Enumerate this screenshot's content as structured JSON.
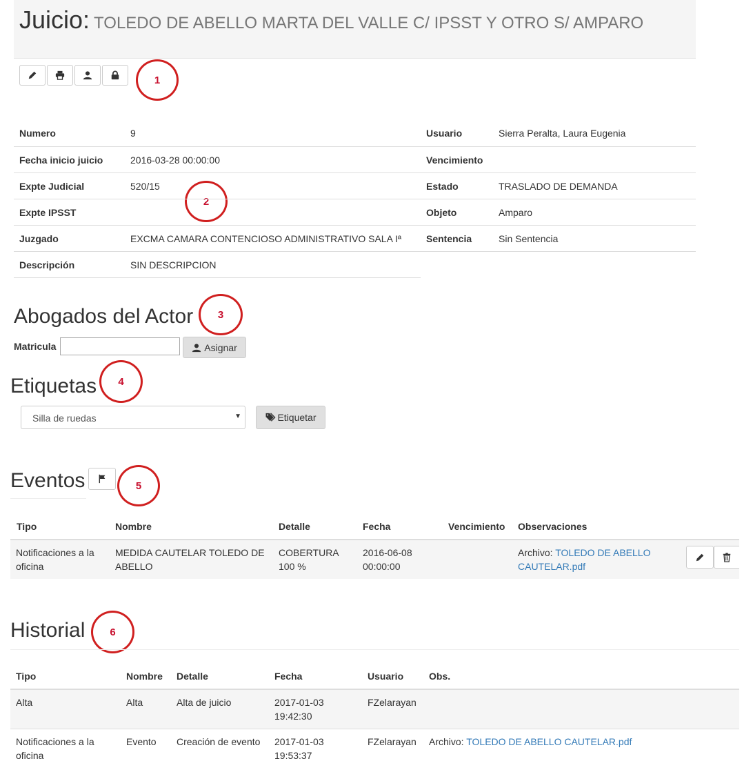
{
  "header": {
    "title_label": "Juicio:",
    "title_case": "TOLEDO DE ABELLO MARTA DEL VALLE C/ IPSST Y OTRO S/ AMPARO"
  },
  "toolbar": {
    "buttons": [
      {
        "icon": "pencil-icon"
      },
      {
        "icon": "print-icon"
      },
      {
        "icon": "user-icon"
      },
      {
        "icon": "lock-icon"
      }
    ]
  },
  "annotations": [
    "1",
    "2",
    "3",
    "4",
    "5",
    "6"
  ],
  "info": {
    "left": [
      {
        "label": "Numero",
        "value": "9"
      },
      {
        "label": "Fecha inicio juicio",
        "value": "2016-03-28 00:00:00"
      },
      {
        "label": "Expte Judicial",
        "value": "520/15"
      },
      {
        "label": "Expte IPSST",
        "value": ""
      },
      {
        "label": "Juzgado",
        "value": "EXCMA CAMARA CONTENCIOSO ADMINISTRATIVO SALA Iª"
      },
      {
        "label": "Descripción",
        "value": "SIN DESCRIPCION"
      }
    ],
    "right": [
      {
        "label": "Usuario",
        "value": "Sierra Peralta, Laura Eugenia"
      },
      {
        "label": "Vencimiento",
        "value": ""
      },
      {
        "label": "Estado",
        "value": "TRASLADO DE DEMANDA"
      },
      {
        "label": "Objeto",
        "value": "Amparo"
      },
      {
        "label": "Sentencia",
        "value": "Sin Sentencia"
      }
    ]
  },
  "abogados": {
    "heading": "Abogados del Actor",
    "matricula_label": "Matricula",
    "matricula_value": "",
    "assign_label": "Asignar"
  },
  "etiquetas": {
    "heading": "Etiquetas",
    "selected": "Silla de ruedas",
    "button_label": "Etiquetar"
  },
  "eventos": {
    "heading": "Eventos",
    "columns": [
      "Tipo",
      "Nombre",
      "Detalle",
      "Fecha",
      "Vencimiento",
      "Observaciones"
    ],
    "rows": [
      {
        "tipo": "Notificaciones a la oficina",
        "nombre": "MEDIDA CAUTELAR TOLEDO DE ABELLO",
        "detalle": "COBERTURA 100 %",
        "fecha": "2016-06-08 00:00:00",
        "vencimiento": "",
        "obs_prefix": "Archivo:",
        "obs_link": "TOLEDO DE ABELLO CAUTELAR.pdf"
      }
    ]
  },
  "historial": {
    "heading": "Historial",
    "columns": [
      "Tipo",
      "Nombre",
      "Detalle",
      "Fecha",
      "Usuario",
      "Obs."
    ],
    "rows": [
      {
        "tipo": "Alta",
        "nombre": "Alta",
        "detalle": "Alta de juicio",
        "fecha": "2017-01-03 19:42:30",
        "usuario": "FZelarayan",
        "obs_prefix": "",
        "obs_link": ""
      },
      {
        "tipo": "Notificaciones a la oficina",
        "nombre": "Evento",
        "detalle": "Creación de evento",
        "fecha": "2017-01-03 19:53:37",
        "usuario": "FZelarayan",
        "obs_prefix": "Archivo:",
        "obs_link": "TOLEDO DE ABELLO CAUTELAR.pdf"
      }
    ]
  },
  "colors": {
    "link": "#337ab7",
    "annotation": "#d01f1f",
    "stripe": "#f5f5f5"
  }
}
